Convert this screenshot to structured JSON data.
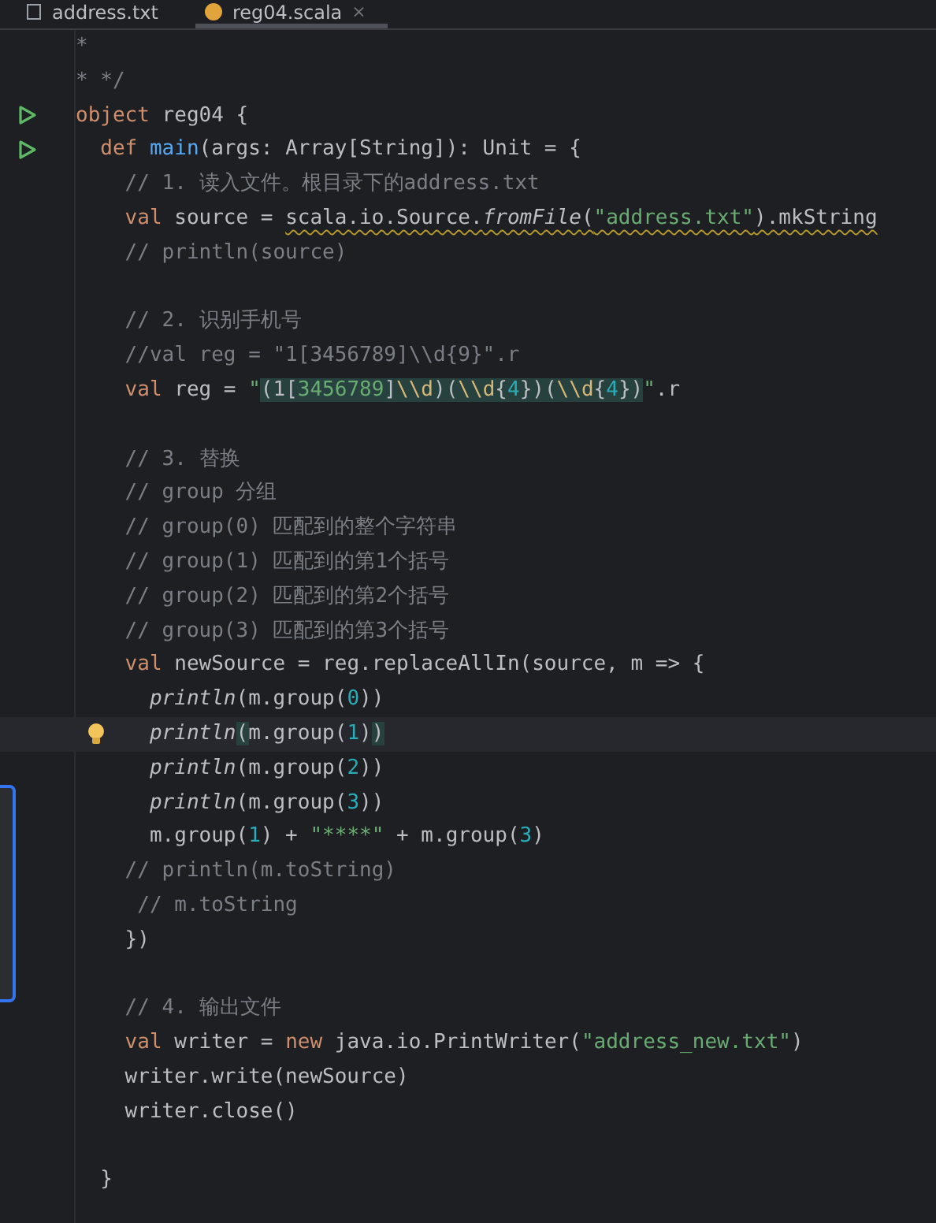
{
  "tabs": [
    {
      "label": "address.txt",
      "selected": false
    },
    {
      "label": "reg04.scala",
      "selected": true,
      "close": "×"
    }
  ],
  "lines": [
    {
      "tokens": [
        {
          "text": "*",
          "kind": "comment"
        }
      ]
    },
    {
      "tokens": [
        {
          "text": "* */",
          "kind": "comment"
        }
      ]
    },
    {
      "kind": "runnable",
      "tokens": [
        {
          "text": "object",
          "kind": "keyword"
        },
        {
          "text": " reg04 {",
          "kind": "plain"
        }
      ]
    },
    {
      "kind": "runnable",
      "tokens": [
        {
          "text": "  def",
          "kind": "keyword"
        },
        {
          "text": " main",
          "kind": "function"
        },
        {
          "text": "(args: Array[String]): Unit = {",
          "kind": "plain"
        }
      ]
    },
    {
      "tokens": [
        {
          "text": "    // 1. 读入文件。根目录下的address.txt",
          "kind": "comment"
        }
      ]
    },
    {
      "tokens": [
        {
          "text": "    val",
          "kind": "keyword"
        },
        {
          "text": " source = ",
          "kind": "plain"
        },
        {
          "text": "scala.io.Source.",
          "kind": "plain",
          "warning": true
        },
        {
          "text": "fromFile",
          "kind": "italic",
          "warning": true
        },
        {
          "text": "(",
          "kind": "plain",
          "warning": true
        },
        {
          "text": "\"address.txt\"",
          "kind": "string",
          "warning": true
        },
        {
          "text": ").mkString",
          "kind": "plain",
          "warning": true
        }
      ]
    },
    {
      "tokens": [
        {
          "text": "    // println(source)",
          "kind": "comment"
        }
      ]
    },
    {
      "kind": "blank"
    },
    {
      "tokens": [
        {
          "text": "    // 2. 识别手机号",
          "kind": "comment"
        }
      ]
    },
    {
      "tokens": [
        {
          "text": "    //val reg = \"1[3456789]\\\\d{9}\".r",
          "kind": "comment"
        }
      ]
    },
    {
      "tokens": [
        {
          "text": "    val",
          "kind": "keyword"
        },
        {
          "text": " reg = ",
          "kind": "plain"
        },
        {
          "text": "\"",
          "kind": "string"
        },
        {
          "text": "(1[",
          "kind": "plain",
          "highlight": true
        },
        {
          "text": "3456789",
          "kind": "string",
          "highlight": true
        },
        {
          "text": "]",
          "kind": "plain",
          "highlight": true
        },
        {
          "text": "\\\\d",
          "kind": "escape",
          "highlight": true
        },
        {
          "text": ")(",
          "kind": "plain",
          "highlight": true
        },
        {
          "text": "\\\\d",
          "kind": "escape",
          "highlight": true
        },
        {
          "text": "{",
          "kind": "plain",
          "highlight": true
        },
        {
          "text": "4",
          "kind": "number",
          "highlight": true
        },
        {
          "text": "})(",
          "kind": "plain",
          "highlight": true
        },
        {
          "text": "\\\\d",
          "kind": "escape",
          "highlight": true
        },
        {
          "text": "{",
          "kind": "plain",
          "highlight": true
        },
        {
          "text": "4",
          "kind": "number",
          "highlight": true
        },
        {
          "text": "})",
          "kind": "plain",
          "highlight": true
        },
        {
          "text": "\"",
          "kind": "string"
        },
        {
          "text": ".r",
          "kind": "plain"
        }
      ]
    },
    {
      "kind": "blank"
    },
    {
      "tokens": [
        {
          "text": "    // 3. 替换",
          "kind": "comment"
        }
      ]
    },
    {
      "tokens": [
        {
          "text": "    // group 分组",
          "kind": "comment"
        }
      ]
    },
    {
      "tokens": [
        {
          "text": "    // group(0) 匹配到的整个字符串",
          "kind": "comment"
        }
      ]
    },
    {
      "tokens": [
        {
          "text": "    // group(1) 匹配到的第1个括号",
          "kind": "comment"
        }
      ]
    },
    {
      "tokens": [
        {
          "text": "    // group(2) 匹配到的第2个括号",
          "kind": "comment"
        }
      ]
    },
    {
      "tokens": [
        {
          "text": "    // group(3) 匹配到的第3个括号",
          "kind": "comment"
        }
      ]
    },
    {
      "tokens": [
        {
          "text": "    val",
          "kind": "keyword"
        },
        {
          "text": " newSource = reg.replaceAllIn(source, m => {",
          "kind": "plain"
        }
      ]
    },
    {
      "tokens": [
        {
          "text": "      println",
          "kind": "italic"
        },
        {
          "text": "(m.group(",
          "kind": "plain"
        },
        {
          "text": "0",
          "kind": "number"
        },
        {
          "text": "))",
          "kind": "plain"
        }
      ]
    },
    {
      "current": true,
      "kind": "hint",
      "tokens": [
        {
          "text": "      println",
          "kind": "italic"
        },
        {
          "text": "(",
          "kind": "plain",
          "highlight": true
        },
        {
          "text": "m.group(",
          "kind": "plain"
        },
        {
          "text": "1",
          "kind": "number"
        },
        {
          "text": ")",
          "kind": "plain"
        },
        {
          "text": ")",
          "kind": "plain",
          "highlight": true
        }
      ]
    },
    {
      "tokens": [
        {
          "text": "      println",
          "kind": "italic"
        },
        {
          "text": "(m.group(",
          "kind": "plain"
        },
        {
          "text": "2",
          "kind": "number"
        },
        {
          "text": "))",
          "kind": "plain"
        }
      ]
    },
    {
      "tokens": [
        {
          "text": "      println",
          "kind": "italic"
        },
        {
          "text": "(m.group(",
          "kind": "plain"
        },
        {
          "text": "3",
          "kind": "number"
        },
        {
          "text": "))",
          "kind": "plain"
        }
      ]
    },
    {
      "tokens": [
        {
          "text": "      m.group(",
          "kind": "plain"
        },
        {
          "text": "1",
          "kind": "number"
        },
        {
          "text": ") + ",
          "kind": "plain"
        },
        {
          "text": "\"****\"",
          "kind": "string"
        },
        {
          "text": " + m.group(",
          "kind": "plain"
        },
        {
          "text": "3",
          "kind": "number"
        },
        {
          "text": ")",
          "kind": "plain"
        }
      ]
    },
    {
      "tokens": [
        {
          "text": "    // println(m.toString)",
          "kind": "comment"
        }
      ]
    },
    {
      "tokens": [
        {
          "text": "     // m.toString",
          "kind": "comment"
        }
      ]
    },
    {
      "tokens": [
        {
          "text": "    })",
          "kind": "plain"
        }
      ]
    },
    {
      "kind": "blank"
    },
    {
      "tokens": [
        {
          "text": "    // 4. 输出文件",
          "kind": "comment"
        }
      ]
    },
    {
      "tokens": [
        {
          "text": "    val",
          "kind": "keyword"
        },
        {
          "text": " writer = ",
          "kind": "plain"
        },
        {
          "text": "new",
          "kind": "keyword"
        },
        {
          "text": " java.io.PrintWriter(",
          "kind": "plain"
        },
        {
          "text": "\"address_new.txt\"",
          "kind": "string"
        },
        {
          "text": ")",
          "kind": "plain"
        }
      ]
    },
    {
      "tokens": [
        {
          "text": "    writer.write(newSource)",
          "kind": "plain"
        }
      ]
    },
    {
      "tokens": [
        {
          "text": "    writer.close()",
          "kind": "plain"
        }
      ]
    },
    {
      "kind": "blank"
    },
    {
      "tokens": [
        {
          "text": "  }",
          "kind": "plain"
        }
      ]
    }
  ]
}
